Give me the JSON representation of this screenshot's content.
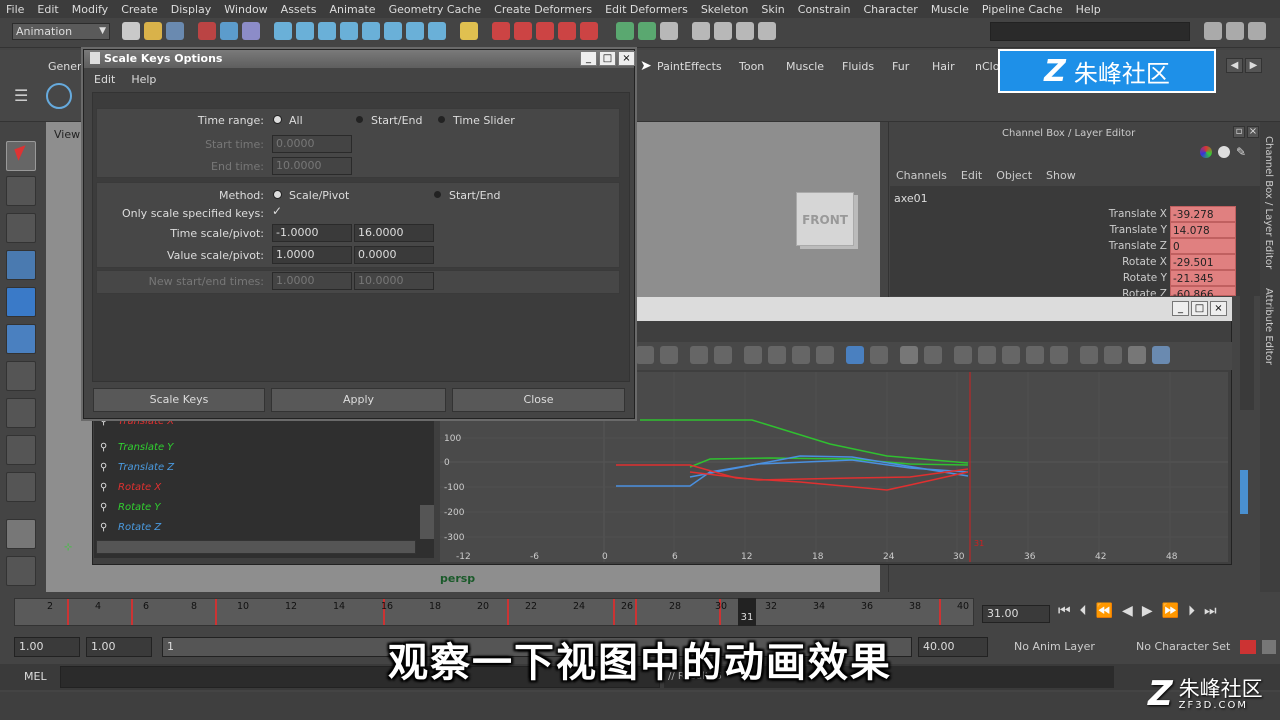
{
  "menubar": [
    "File",
    "Edit",
    "Modify",
    "Create",
    "Display",
    "Window",
    "Assets",
    "Animate",
    "Geometry Cache",
    "Create Deformers",
    "Edit Deformers",
    "Skeleton",
    "Skin",
    "Constrain",
    "Character",
    "Muscle",
    "Pipeline Cache",
    "Help"
  ],
  "status": {
    "mode": "Animation"
  },
  "shelf": {
    "tabs_left": "Genera",
    "tabs_right": [
      "PaintEffects",
      "Toon",
      "Muscle",
      "Fluids",
      "Fur",
      "Hair",
      "nClo"
    ]
  },
  "watermark": {
    "text": "朱峰社区"
  },
  "viewport": {
    "menu": "View",
    "viewcube": "FRONT",
    "camera": "persp"
  },
  "channelbox": {
    "title": "Channel Box / Layer Editor",
    "menu": [
      "Channels",
      "Edit",
      "Object",
      "Show"
    ],
    "object": "axe01",
    "attrs": [
      {
        "label": "Translate X",
        "value": "-39.278"
      },
      {
        "label": "Translate Y",
        "value": "14.078"
      },
      {
        "label": "Translate Z",
        "value": "0"
      },
      {
        "label": "Rotate X",
        "value": "-29.501"
      },
      {
        "label": "Rotate Y",
        "value": "-21.345"
      },
      {
        "label": "Rotate Z",
        "value": "-60.866"
      }
    ],
    "side_tabs": [
      "Channel Box / Layer Editor",
      "Attribute Editor"
    ]
  },
  "dialog": {
    "title": "Scale Keys Options",
    "menu": [
      "Edit",
      "Help"
    ],
    "time_range_label": "Time range:",
    "time_range_options": [
      "All",
      "Start/End",
      "Time Slider"
    ],
    "start_time_label": "Start time:",
    "start_time": "0.0000",
    "end_time_label": "End time:",
    "end_time": "10.0000",
    "method_label": "Method:",
    "method_options": [
      "Scale/Pivot",
      "Start/End"
    ],
    "only_scale_label": "Only scale specified keys:",
    "only_scale_check": "✓",
    "time_scale_label": "Time scale/pivot:",
    "time_scale": "-1.0000",
    "time_pivot": "16.0000",
    "value_scale_label": "Value scale/pivot:",
    "value_scale": "1.0000",
    "value_pivot": "0.0000",
    "new_se_label": "New start/end times:",
    "new_start": "1.0000",
    "new_end": "10.0000",
    "buttons": [
      "Scale Keys",
      "Apply",
      "Close"
    ]
  },
  "graph": {
    "outliner": [
      {
        "name": "Translate X",
        "color": "#e03030"
      },
      {
        "name": "Translate Y",
        "color": "#30d030"
      },
      {
        "name": "Translate Z",
        "color": "#4a9ae0"
      },
      {
        "name": "Rotate X",
        "color": "#e03030"
      },
      {
        "name": "Rotate Y",
        "color": "#30d030"
      },
      {
        "name": "Rotate Z",
        "color": "#4a9ae0"
      }
    ],
    "y_ticks": [
      "100",
      "0",
      "-100",
      "-200",
      "-300"
    ],
    "x_ticks": [
      "-12",
      "-6",
      "0",
      "6",
      "12",
      "18",
      "24",
      "30",
      "36",
      "42",
      "48"
    ],
    "current_label": "31"
  },
  "timeline": {
    "labels": [
      "2",
      "4",
      "6",
      "8",
      "10",
      "12",
      "14",
      "16",
      "18",
      "20",
      "22",
      "24",
      "26",
      "28",
      "30",
      "32",
      "34",
      "36",
      "38",
      "40"
    ],
    "current_frame": "31",
    "current_time": "31.00"
  },
  "range": {
    "start": "1.00",
    "playback_start": "1.00",
    "slider_start": "1",
    "end": "40.00",
    "anim_layer": "No Anim Layer",
    "character_set": "No Character Set"
  },
  "mel": {
    "label": "MEL",
    "result": "// Result: 6"
  },
  "subtitle": "观察一下视图中的动画效果",
  "corner_logo": {
    "title": "朱峰社区",
    "site": "ZF3D.COM"
  },
  "colors": {
    "accent": "#1e90e8",
    "key_red": "#e08080"
  }
}
